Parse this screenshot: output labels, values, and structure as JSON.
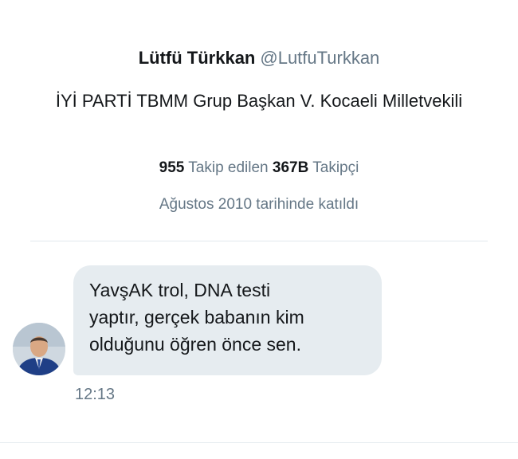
{
  "profile": {
    "display_name": "Lütfü Türkkan",
    "handle": "@LutfuTurkkan",
    "bio": "İYİ PARTİ TBMM Grup Başkan V. Kocaeli Milletvekili",
    "following_count": "955",
    "following_label": "Takip edilen",
    "followers_count": "367B",
    "followers_label": "Takipçi",
    "joined": "Ağustos 2010 tarihinde katıldı"
  },
  "message": {
    "text": "YavşAK trol, DNA testi\nyaptır, gerçek babanın kim\nolduğunu öğren önce sen.",
    "time": "12:13",
    "bubble_color": "#e6ecf0"
  },
  "colors": {
    "primary_text": "#14171a",
    "secondary_text": "#657786",
    "divider": "#e1e8ed"
  }
}
